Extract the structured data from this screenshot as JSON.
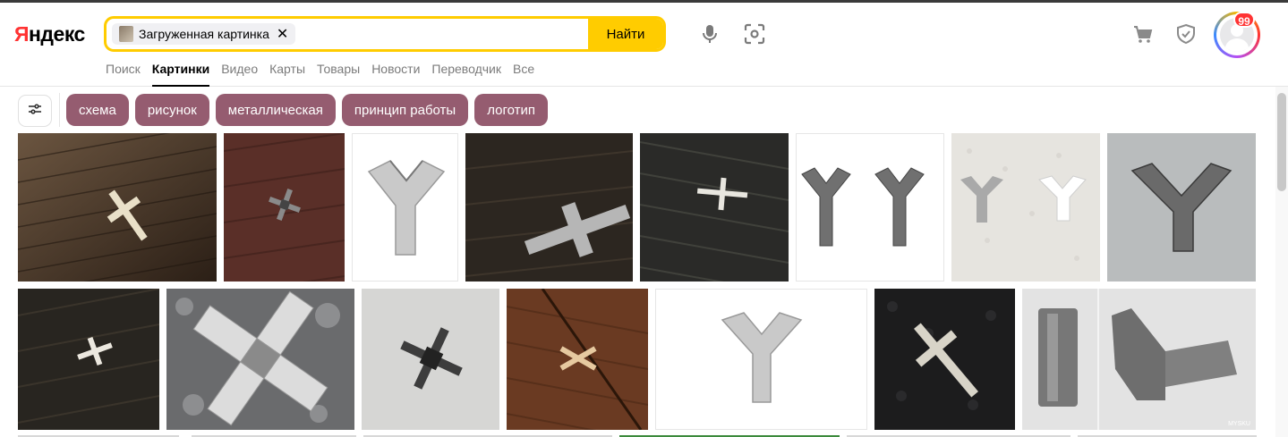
{
  "logo": {
    "first": "Я",
    "rest": "ндекс"
  },
  "search": {
    "chip_label": "Загруженная картинка",
    "chip_remove": "✕",
    "button": "Найти"
  },
  "tabs": [
    "Поиск",
    "Картинки",
    "Видео",
    "Карты",
    "Товары",
    "Новости",
    "Переводчик",
    "Все"
  ],
  "active_tab": "Картинки",
  "user": {
    "notification_count": "99"
  },
  "suggestions": [
    "схема",
    "рисунок",
    "металлическая",
    "принцип работы",
    "логотип"
  ],
  "colors": {
    "search_accent": "#ffcc00",
    "suggestion_chip": "#955c70",
    "logo_accent": "#ff3333"
  },
  "icons": [
    "microphone-icon",
    "camera-scan-icon",
    "cart-icon",
    "shield-check-icon",
    "filter-sliders-icon"
  ],
  "watermark": "MYSKU"
}
